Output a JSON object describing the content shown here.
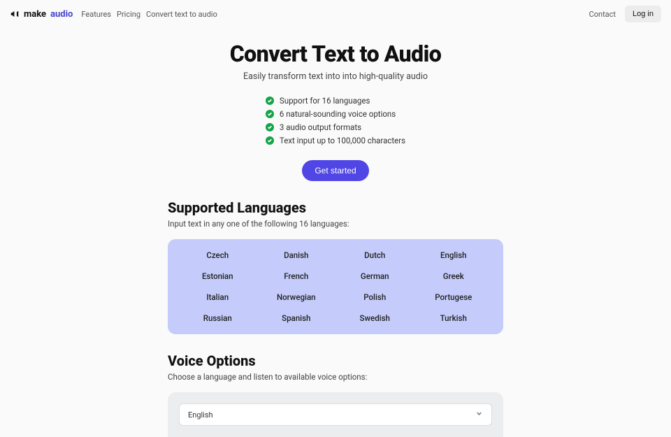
{
  "brand": {
    "make": "make",
    "audio": "audio"
  },
  "nav": {
    "links": [
      "Features",
      "Pricing",
      "Convert text to audio"
    ],
    "contact": "Contact",
    "login": "Log in"
  },
  "hero": {
    "title": "Convert Text to Audio",
    "subtitle": "Easily transform text into into high-quality audio",
    "features": [
      "Support for 16 languages",
      "6 natural-sounding voice options",
      "3 audio output formats",
      "Text input up to 100,000 characters"
    ],
    "cta": "Get started"
  },
  "languages": {
    "title": "Supported Languages",
    "subtitle": "Input text in any one of the following 16 languages:",
    "list": [
      "Czech",
      "Danish",
      "Dutch",
      "English",
      "Estonian",
      "French",
      "German",
      "Greek",
      "Italian",
      "Norwegian",
      "Polish",
      "Portugese",
      "Russian",
      "Spanish",
      "Swedish",
      "Turkish"
    ]
  },
  "voice": {
    "title": "Voice Options",
    "subtitle": "Choose a language and listen to available voice options:",
    "selected": "English"
  }
}
